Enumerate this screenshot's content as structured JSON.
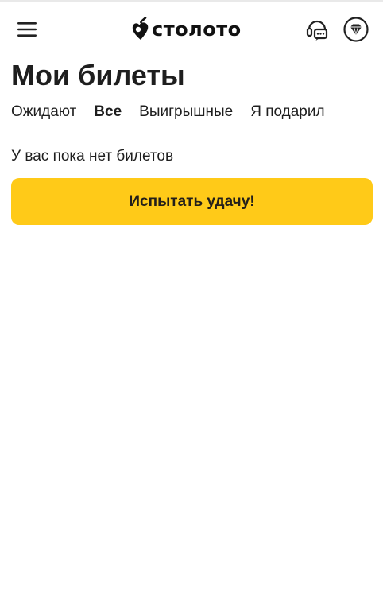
{
  "header": {
    "logo_text": "столото",
    "menu_icon": "hamburger-menu-icon",
    "support_icon": "headset-chat-icon",
    "bonus_icon": "diamond-icon"
  },
  "page": {
    "title": "Мои билеты"
  },
  "tabs": [
    {
      "label": "Ожидают",
      "active": false
    },
    {
      "label": "Все",
      "active": true
    },
    {
      "label": "Выигрышные",
      "active": false
    },
    {
      "label": "Я подарил",
      "active": false
    }
  ],
  "empty_state": {
    "message": "У вас пока нет билетов",
    "cta_label": "Испытать удачу!"
  },
  "colors": {
    "accent_yellow": "#ffca18",
    "text": "#1e1e1e",
    "background": "#ffffff"
  }
}
